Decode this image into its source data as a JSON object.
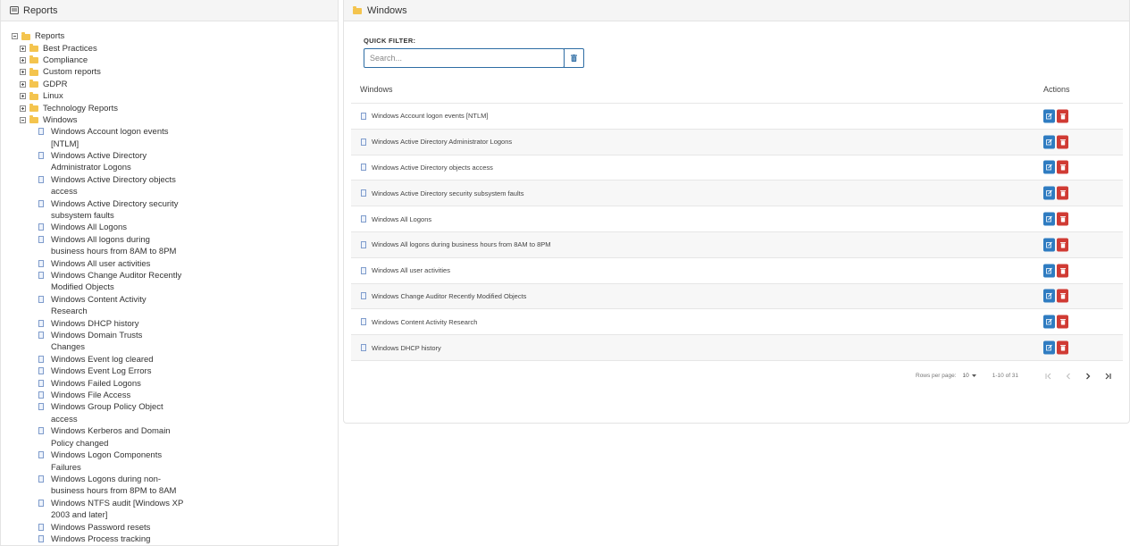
{
  "left_panel": {
    "title": "Reports",
    "icon": "list-icon",
    "root": {
      "label": "Reports"
    },
    "folders": [
      {
        "label": "Best Practices"
      },
      {
        "label": "Compliance"
      },
      {
        "label": "Custom reports"
      },
      {
        "label": "GDPR"
      },
      {
        "label": "Linux"
      },
      {
        "label": "Technology Reports"
      },
      {
        "label": "Windows"
      }
    ],
    "windows_items": [
      {
        "line1": "Windows Account logon events",
        "line2": "[NTLM]"
      },
      {
        "line1": "Windows Active Directory",
        "line2": "Administrator Logons"
      },
      {
        "line1": "Windows Active Directory objects",
        "line2": "access"
      },
      {
        "line1": "Windows Active Directory security",
        "line2": "subsystem faults"
      },
      {
        "line1": "Windows All Logons",
        "line2": ""
      },
      {
        "line1": "Windows All logons during",
        "line2": "business hours from 8AM to 8PM"
      },
      {
        "line1": "Windows All user activities",
        "line2": ""
      },
      {
        "line1": "Windows Change Auditor Recently",
        "line2": "Modified Objects"
      },
      {
        "line1": "Windows Content Activity",
        "line2": "Research"
      },
      {
        "line1": "Windows DHCP history",
        "line2": ""
      },
      {
        "line1": "Windows Domain Trusts",
        "line2": "Changes"
      },
      {
        "line1": "Windows Event log cleared",
        "line2": ""
      },
      {
        "line1": "Windows Event Log Errors",
        "line2": ""
      },
      {
        "line1": "Windows Failed Logons",
        "line2": ""
      },
      {
        "line1": "Windows File Access",
        "line2": ""
      },
      {
        "line1": "Windows Group Policy Object",
        "line2": "access"
      },
      {
        "line1": "Windows Kerberos and Domain",
        "line2": "Policy changed"
      },
      {
        "line1": "Windows Logon Components",
        "line2": "Failures"
      },
      {
        "line1": "Windows Logons during non-",
        "line2": "business hours from 8PM to 8AM"
      },
      {
        "line1": "Windows NTFS audit [Windows XP",
        "line2": "2003 and later]"
      },
      {
        "line1": "Windows Password resets",
        "line2": ""
      },
      {
        "line1": "Windows Process tracking",
        "line2": ""
      }
    ]
  },
  "right_panel": {
    "title": "Windows",
    "quick_filter_label": "QUICK FILTER:",
    "search_placeholder": "Search...",
    "search_value": "",
    "columns": {
      "name": "Windows",
      "actions": "Actions"
    },
    "rows": [
      {
        "label": "Windows Account logon events [NTLM]"
      },
      {
        "label": "Windows Active Directory Administrator Logons"
      },
      {
        "label": "Windows Active Directory objects access"
      },
      {
        "label": "Windows Active Directory security subsystem faults"
      },
      {
        "label": "Windows All Logons"
      },
      {
        "label": "Windows All logons during business hours from 8AM to 8PM"
      },
      {
        "label": "Windows All user activities"
      },
      {
        "label": "Windows Change Auditor Recently Modified Objects"
      },
      {
        "label": "Windows Content Activity Research"
      },
      {
        "label": "Windows DHCP history"
      }
    ],
    "pagination": {
      "rows_per_page_label": "Rows per page:",
      "rows_per_page_value": "10",
      "range_text": "1-10 of 31"
    }
  },
  "colors": {
    "edit_button": "#2f7cc1",
    "delete_button": "#d03b34",
    "folder": "#f4c44e",
    "accent_border": "#2e6da4"
  }
}
